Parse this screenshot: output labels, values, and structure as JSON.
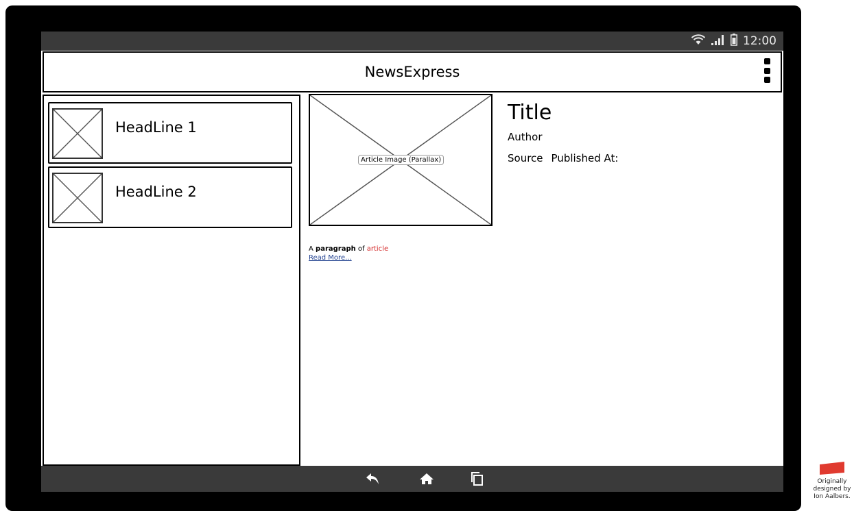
{
  "status_bar": {
    "time": "12:00",
    "icons": [
      "wifi-icon",
      "signal-icon",
      "battery-icon"
    ]
  },
  "app_bar": {
    "title": "NewsExpress",
    "menu_icon": "overflow-menu-icon"
  },
  "headlines": [
    {
      "label": "HeadLine 1",
      "thumbnail_icon": "image-placeholder-icon"
    },
    {
      "label": "HeadLine 2",
      "thumbnail_icon": "image-placeholder-icon"
    }
  ],
  "article": {
    "image_label": "Article Image (Parallax)",
    "title": "Title",
    "author": "Author",
    "source": "Source",
    "published_at": "Published At:",
    "paragraph": {
      "part1": "A ",
      "part2": "paragraph",
      "part3": " of ",
      "part4": "article"
    },
    "read_more": "Read More..."
  },
  "nav_bar": {
    "icons": [
      "back-icon",
      "home-icon",
      "recent-apps-icon"
    ]
  },
  "credit": {
    "line1": "Originally",
    "line2": "designed by",
    "line3": "Ion Aalbers."
  },
  "colors": {
    "device": "#000000",
    "bars": "#3a3a3a",
    "link": "#1f3f8f",
    "highlight": "#d42a2a",
    "credit_logo": "#e03a2f"
  }
}
